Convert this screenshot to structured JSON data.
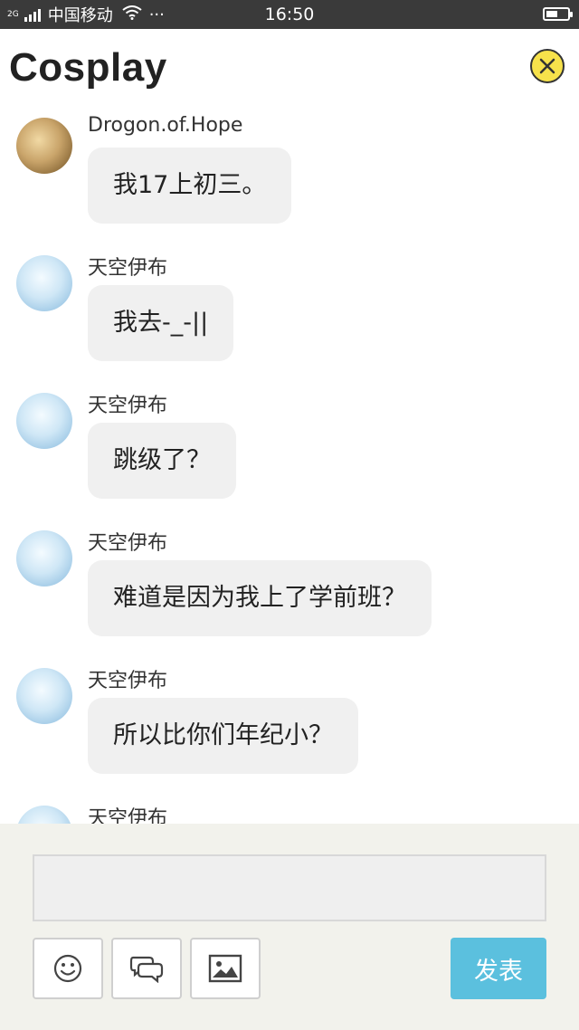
{
  "status_bar": {
    "network": "2G",
    "carrier": "中国移动",
    "dots": "···",
    "time": "16:50"
  },
  "header": {
    "title": "Cosplay"
  },
  "messages": [
    {
      "sender": "Drogon.of.Hope",
      "text": "我17上初三。",
      "avatar": "avatar-dragon"
    },
    {
      "sender": "天空伊布",
      "text": "我去-_-||",
      "avatar": "avatar-sky"
    },
    {
      "sender": "天空伊布",
      "text": "跳级了？",
      "avatar": "avatar-sky"
    },
    {
      "sender": "天空伊布",
      "text": "难道是因为我上了学前班？",
      "avatar": "avatar-sky"
    },
    {
      "sender": "天空伊布",
      "text": "所以比你们年纪小？",
      "avatar": "avatar-sky"
    },
    {
      "sender": "天空伊布",
      "text": "",
      "avatar": "avatar-sky"
    }
  ],
  "composer": {
    "input_value": "",
    "icons": [
      "smiley-icon",
      "chat-bubbles-icon",
      "image-icon"
    ],
    "send_label": "发表"
  },
  "colors": {
    "accent": "#5bc0de",
    "close_button": "#f7e24b",
    "bubble": "#f0f0f0",
    "composer_bg": "#f2f2ec"
  }
}
